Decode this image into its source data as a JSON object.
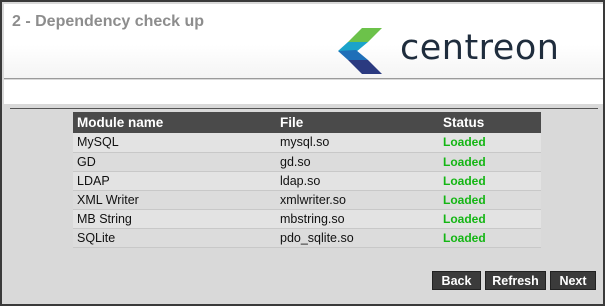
{
  "header": {
    "step_title": "2 - Dependency check up",
    "logo_text": "centreon"
  },
  "table": {
    "columns": [
      "Module name",
      "File",
      "Status"
    ],
    "rows": [
      {
        "module": "MySQL",
        "file": "mysql.so",
        "status": "Loaded"
      },
      {
        "module": "GD",
        "file": "gd.so",
        "status": "Loaded"
      },
      {
        "module": "LDAP",
        "file": "ldap.so",
        "status": "Loaded"
      },
      {
        "module": "XML Writer",
        "file": "xmlwriter.so",
        "status": "Loaded"
      },
      {
        "module": "MB String",
        "file": "mbstring.so",
        "status": "Loaded"
      },
      {
        "module": "SQLite",
        "file": "pdo_sqlite.so",
        "status": "Loaded"
      }
    ]
  },
  "buttons": {
    "back": "Back",
    "refresh": "Refresh",
    "next": "Next"
  },
  "colors": {
    "status_ok": "#14b614",
    "header_bg": "#4a4a4a",
    "logo_dark": "#1f2d3d"
  }
}
